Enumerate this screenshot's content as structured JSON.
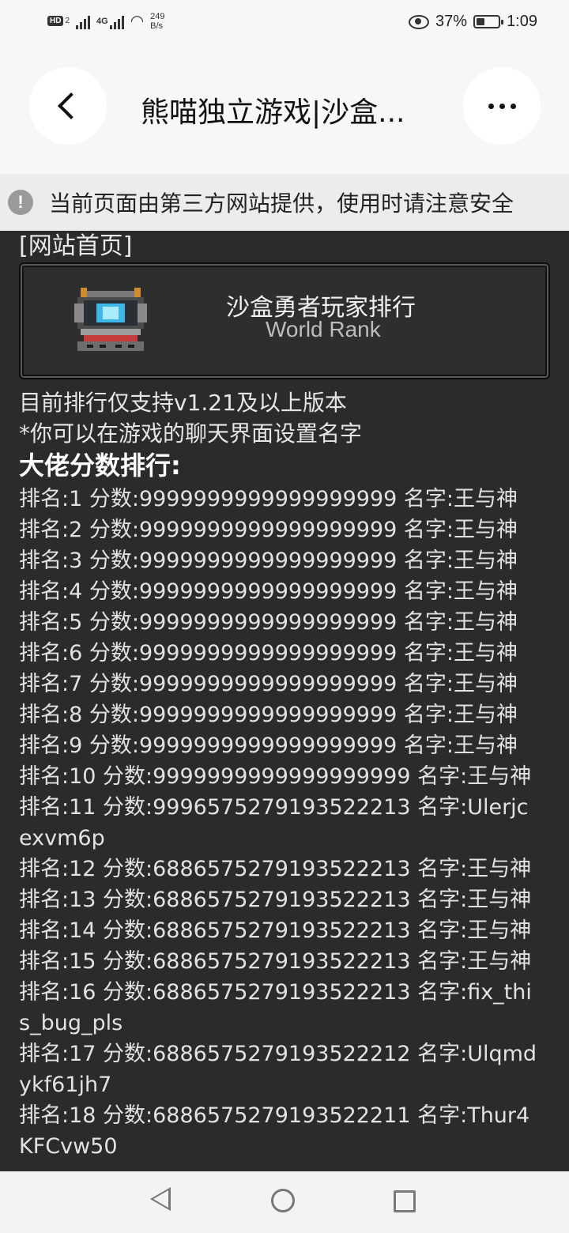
{
  "status_bar": {
    "hd_badge": "HD",
    "sim_label": "2",
    "network": "4G",
    "net_speed_value": "249",
    "net_speed_unit": "B/s",
    "battery": "37%",
    "time": "1:09"
  },
  "title_bar": {
    "title": "熊喵独立游戏|沙盒..."
  },
  "warning": {
    "text": "当前页面由第三方网站提供，使用时请注意安全"
  },
  "content": {
    "home_link": "[网站首页]",
    "card": {
      "title": "沙盒勇者玩家排行",
      "subtitle": "World Rank"
    },
    "notice1": "目前排行仅支持v1.21及以上版本",
    "notice2": "*你可以在游戏的聊天界面设置名字",
    "leaderboard_heading": "大佬分数排行:",
    "ranks": [
      "排名:1 分数:9999999999999999999 名字:王与神",
      "排名:2 分数:9999999999999999999 名字:王与神",
      "排名:3 分数:9999999999999999999 名字:王与神",
      "排名:4 分数:9999999999999999999 名字:王与神",
      "排名:5 分数:9999999999999999999 名字:王与神",
      "排名:6 分数:9999999999999999999 名字:王与神",
      "排名:7 分数:9999999999999999999 名字:王与神",
      "排名:8 分数:9999999999999999999 名字:王与神",
      "排名:9 分数:9999999999999999999 名字:王与神",
      "排名:10 分数:9999999999999999999 名字:王与神",
      "排名:11 分数:9996575279193522213 名字:Ulerjcexvm6p",
      "排名:12 分数:6886575279193522213 名字:王与神",
      "排名:13 分数:6886575279193522213 名字:王与神",
      "排名:14 分数:6886575279193522213 名字:王与神",
      "排名:15 分数:6886575279193522213 名字:王与神",
      "排名:16 分数:6886575279193522213 名字:fix_this_bug_pls",
      "排名:17 分数:6886575279193522212 名字:Ulqmdykf61jh7",
      "排名:18 分数:6886575279193522211 名字:Thur4KFCvw50"
    ]
  },
  "icons": {
    "back": "back-chevron-icon",
    "more": "more-dots-icon",
    "warning": "exclamation-icon",
    "chest": "pixel-chest-icon"
  },
  "colors": {
    "page_bg": "#2b2b2b",
    "chrome_bg": "#f7f7f7",
    "warning_bg": "#ececec"
  }
}
